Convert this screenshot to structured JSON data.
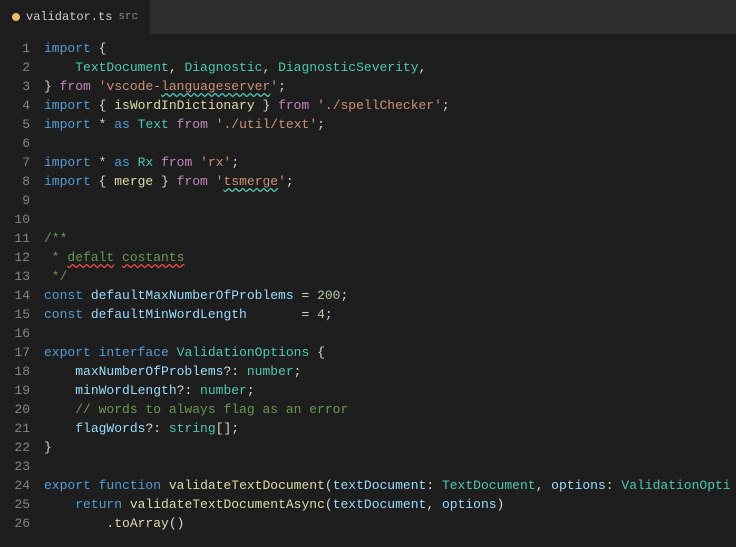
{
  "tab": {
    "filename": "validator.ts",
    "src_label": "src",
    "modified_dot": true
  },
  "lines": [
    {
      "num": 1,
      "content": "import_keyword"
    },
    {
      "num": 2,
      "content": "textdocument_line"
    },
    {
      "num": 3,
      "content": "from_vscode"
    },
    {
      "num": 4,
      "content": "import_spellchecker"
    },
    {
      "num": 5,
      "content": "import_text"
    },
    {
      "num": 6,
      "content": "empty"
    },
    {
      "num": 7,
      "content": "import_rx"
    },
    {
      "num": 8,
      "content": "import_tsmerge"
    },
    {
      "num": 9,
      "content": "empty"
    },
    {
      "num": 10,
      "content": "empty"
    },
    {
      "num": 11,
      "content": "jsdoc_start"
    },
    {
      "num": 12,
      "content": "jsdoc_defalt"
    },
    {
      "num": 13,
      "content": "jsdoc_end"
    },
    {
      "num": 14,
      "content": "const_maxproblems"
    },
    {
      "num": 15,
      "content": "const_minwordlength"
    },
    {
      "num": 16,
      "content": "empty"
    },
    {
      "num": 17,
      "content": "export_interface"
    },
    {
      "num": 18,
      "content": "maxnumberofproblems"
    },
    {
      "num": 19,
      "content": "minwordlength_prop"
    },
    {
      "num": 20,
      "content": "comment_words"
    },
    {
      "num": 21,
      "content": "flagwords_prop"
    },
    {
      "num": 22,
      "content": "close_brace"
    },
    {
      "num": 23,
      "content": "empty"
    },
    {
      "num": 24,
      "content": "export_function"
    },
    {
      "num": 25,
      "content": "return_validate"
    },
    {
      "num": 26,
      "content": "toarray"
    }
  ]
}
